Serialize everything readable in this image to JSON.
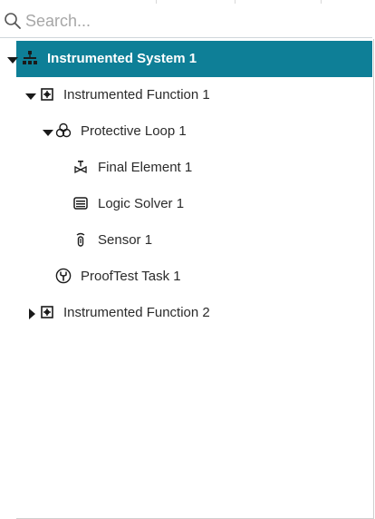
{
  "search": {
    "placeholder": "Search..."
  },
  "colors": {
    "selected_bg": "#0e7f97",
    "text": "#2b2b2b",
    "icon": "#222222"
  },
  "tree": [
    {
      "label": "Instrumented System 1",
      "icon": "hierarchy-icon",
      "toggle": "expanded",
      "selected": true
    },
    {
      "label": "Instrumented Function 1",
      "icon": "function-icon",
      "toggle": "expanded",
      "selected": false
    },
    {
      "label": "Protective Loop 1",
      "icon": "loop-icon",
      "toggle": "expanded",
      "selected": false
    },
    {
      "label": "Final Element 1",
      "icon": "final-element-icon",
      "toggle": "none",
      "selected": false
    },
    {
      "label": "Logic Solver 1",
      "icon": "logic-solver-icon",
      "toggle": "none",
      "selected": false
    },
    {
      "label": "Sensor 1",
      "icon": "sensor-icon",
      "toggle": "none",
      "selected": false
    },
    {
      "label": "ProofTest Task 1",
      "icon": "wrench-icon",
      "toggle": "none",
      "selected": false
    },
    {
      "label": "Instrumented Function 2",
      "icon": "function-icon",
      "toggle": "collapsed",
      "selected": false
    }
  ]
}
